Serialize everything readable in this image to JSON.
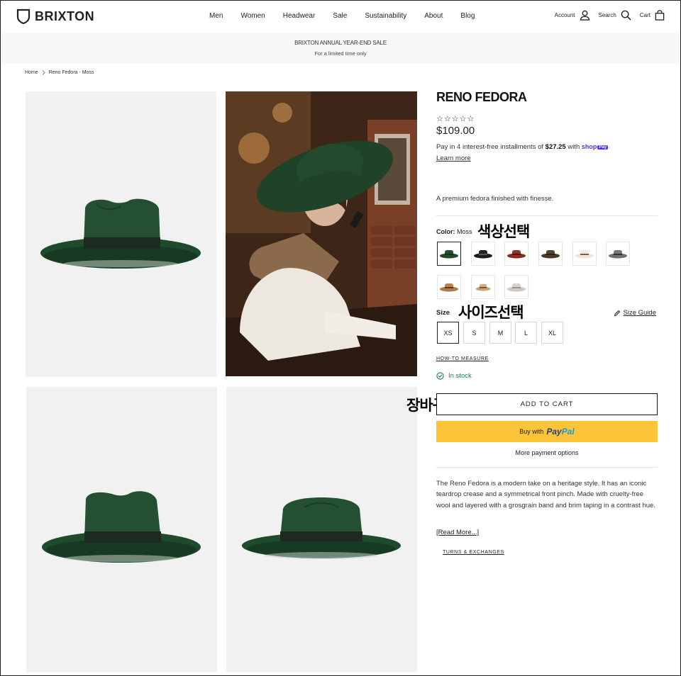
{
  "header": {
    "logo": "BRIXTON",
    "nav": [
      "Men",
      "Women",
      "Headwear",
      "Sale",
      "Sustainability",
      "About",
      "Blog"
    ],
    "account_label": "Account",
    "search_label": "Search",
    "cart_label": "Cart"
  },
  "banner": {
    "line1": "BRIXTON ANNUAL YEAR-END SALE",
    "line2": "For a limited time only"
  },
  "breadcrumb": {
    "home": "Home",
    "current": "Reno Fedora - Moss"
  },
  "product": {
    "title": "RENO FEDORA",
    "stars": "☆☆☆☆☆",
    "price": "$109.00",
    "installments_prefix": "Pay in 4 interest-free installments of ",
    "installment_amount": "$27.25",
    "installments_mid": " with ",
    "shop_pay": "shop",
    "shop_pay_badge": "Pay",
    "learn_more": "Learn more",
    "short_description": "A premium fedora finished with finesse.",
    "color_label": "Color:",
    "color_value": "Moss",
    "colors": [
      {
        "name": "Moss",
        "hex": "#2c4a32"
      },
      {
        "name": "Black",
        "hex": "#1c1c1c"
      },
      {
        "name": "Red",
        "hex": "#8b2a24"
      },
      {
        "name": "Brown",
        "hex": "#4a3a22"
      },
      {
        "name": "Off White",
        "hex": "#ece6da"
      },
      {
        "name": "Grey",
        "hex": "#6e6e70"
      },
      {
        "name": "Tan",
        "hex": "#b07a4a"
      },
      {
        "name": "Sand",
        "hex": "#c9a27a"
      },
      {
        "name": "Light Grey",
        "hex": "#cfc9c4"
      }
    ],
    "size_label": "Size",
    "size_guide": "Size Guide",
    "sizes": [
      "XS",
      "S",
      "M",
      "L",
      "XL"
    ],
    "how_to_measure": "HOW-TO MEASURE",
    "stock": "In stock",
    "add_to_cart": "ADD TO CART",
    "buy_with": "Buy with",
    "paypal_1": "Pay",
    "paypal_2": "Pal",
    "more_payment": "More payment options",
    "long_description": "The Reno Fedora is a modern take on a heritage style. It has an iconic teardrop crease and a symmetrical front pinch. Made with cruelty-free wool and layered with a grosgrain band and brim taping in a contrast hue.",
    "read_more": "[Read More...]",
    "returns": "TURNS & EXCHANGES"
  },
  "annotations": {
    "color": "색상선택",
    "size": "사이즈선택",
    "cart": "장바구니 담기"
  },
  "colors": {
    "moss": "#1f4a2c",
    "in_stock": "#1f7a44",
    "paypal_yellow": "#fcc439",
    "banner_bg": "#f6f7f9"
  }
}
